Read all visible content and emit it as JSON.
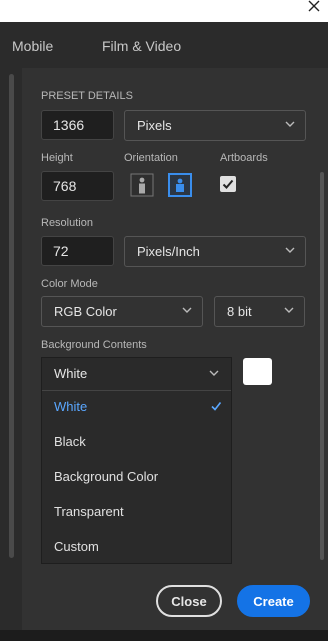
{
  "tabs": [
    "Mobile",
    "Film & Video"
  ],
  "preset": {
    "section_title": "PRESET DETAILS",
    "width_value": "1366",
    "width_unit": "Pixels",
    "height_label": "Height",
    "height_value": "768",
    "orientation_label": "Orientation",
    "artboards_label": "Artboards",
    "artboards_checked": true,
    "resolution_label": "Resolution",
    "resolution_value": "72",
    "resolution_unit": "Pixels/Inch",
    "color_mode_label": "Color Mode",
    "color_mode_value": "RGB Color",
    "bit_depth_value": "8 bit",
    "background_label": "Background Contents",
    "background_selected": "White",
    "background_swatch_color": "#ffffff",
    "background_options": [
      "White",
      "Black",
      "Background Color",
      "Transparent",
      "Custom"
    ]
  },
  "buttons": {
    "close_label": "Close",
    "create_label": "Create"
  },
  "colors": {
    "accent": "#1473e6",
    "selected_option": "#5aa7ff"
  }
}
